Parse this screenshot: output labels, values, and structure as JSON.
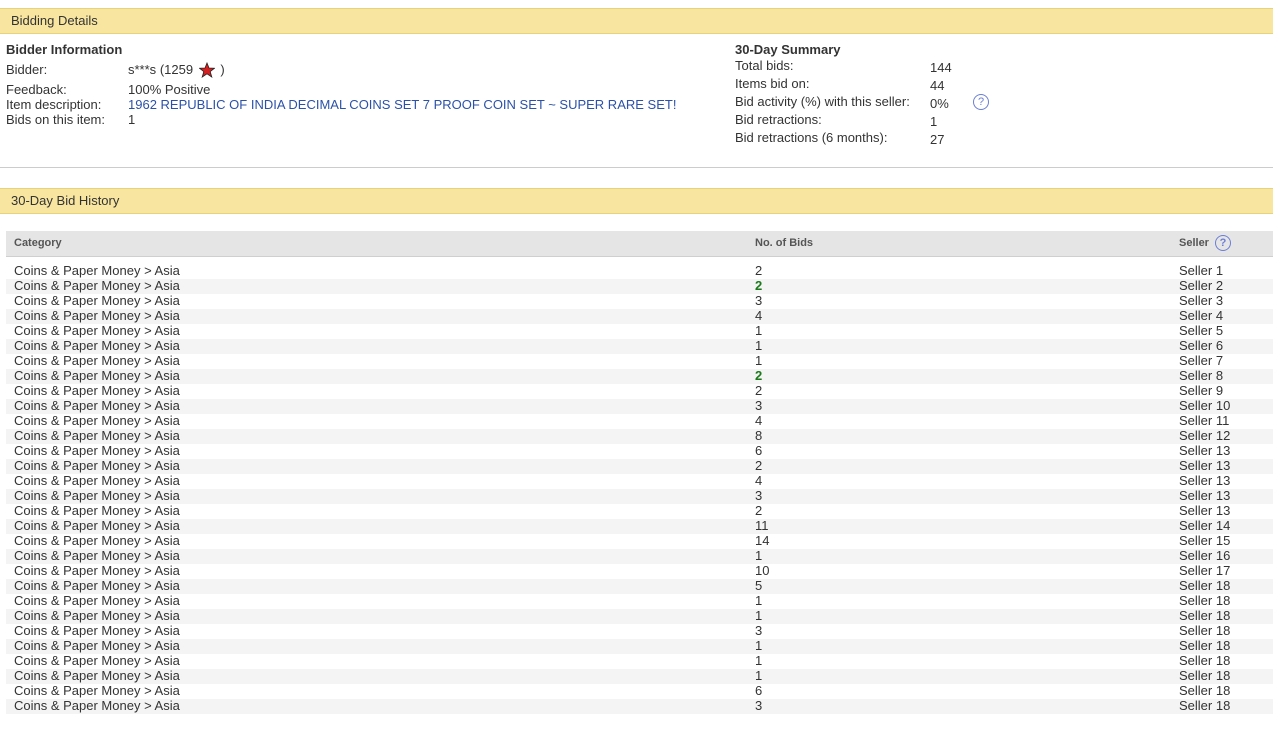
{
  "bidding_details": {
    "section_title": "Bidding Details",
    "bidder_info": {
      "title": "Bidder Information",
      "bidder_label": "Bidder:",
      "bidder_name": "s***s",
      "feedback_open": "(",
      "feedback_score": "1259",
      "feedback_close": ")",
      "star_color": "#d42020",
      "feedback_label": "Feedback:",
      "feedback_value": "100% Positive",
      "item_desc_label": "Item description:",
      "item_desc_value": "1962 REPUBLIC OF INDIA DECIMAL COINS SET 7 PROOF COIN SET ~ SUPER RARE SET!",
      "bids_on_item_label": "Bids on this item:",
      "bids_on_item_value": "1"
    },
    "summary": {
      "title": "30-Day Summary",
      "total_bids_label": "Total bids:",
      "total_bids_value": "144",
      "items_bid_label": "Items bid on:",
      "items_bid_value": "44",
      "activity_label": "Bid activity (%) with this seller:",
      "activity_value": "0%",
      "retractions_label": "Bid retractions:",
      "retractions_value": "1",
      "retractions6_label": "Bid retractions (6 months):",
      "retractions6_value": "27",
      "help_icon": "?"
    }
  },
  "history": {
    "section_title": "30-Day Bid History",
    "columns": {
      "category": "Category",
      "bids": "No. of Bids",
      "seller": "Seller",
      "help_icon": "?"
    },
    "rows": [
      {
        "category": "Coins & Paper Money > Asia",
        "bids": "2",
        "seller": "Seller 1",
        "highlight": false
      },
      {
        "category": "Coins & Paper Money > Asia",
        "bids": "2",
        "seller": "Seller 2",
        "highlight": true
      },
      {
        "category": "Coins & Paper Money > Asia",
        "bids": "3",
        "seller": "Seller 3",
        "highlight": false
      },
      {
        "category": "Coins & Paper Money > Asia",
        "bids": "4",
        "seller": "Seller 4",
        "highlight": false
      },
      {
        "category": "Coins & Paper Money > Asia",
        "bids": "1",
        "seller": "Seller 5",
        "highlight": false
      },
      {
        "category": "Coins & Paper Money > Asia",
        "bids": "1",
        "seller": "Seller 6",
        "highlight": false
      },
      {
        "category": "Coins & Paper Money > Asia",
        "bids": "1",
        "seller": "Seller 7",
        "highlight": false
      },
      {
        "category": "Coins & Paper Money > Asia",
        "bids": "2",
        "seller": "Seller 8",
        "highlight": true
      },
      {
        "category": "Coins & Paper Money > Asia",
        "bids": "2",
        "seller": "Seller 9",
        "highlight": false
      },
      {
        "category": "Coins & Paper Money > Asia",
        "bids": "3",
        "seller": "Seller 10",
        "highlight": false
      },
      {
        "category": "Coins & Paper Money > Asia",
        "bids": "4",
        "seller": "Seller 11",
        "highlight": false
      },
      {
        "category": "Coins & Paper Money > Asia",
        "bids": "8",
        "seller": "Seller 12",
        "highlight": false
      },
      {
        "category": "Coins & Paper Money > Asia",
        "bids": "6",
        "seller": "Seller 13",
        "highlight": false
      },
      {
        "category": "Coins & Paper Money > Asia",
        "bids": "2",
        "seller": "Seller 13",
        "highlight": false
      },
      {
        "category": "Coins & Paper Money > Asia",
        "bids": "4",
        "seller": "Seller 13",
        "highlight": false
      },
      {
        "category": "Coins & Paper Money > Asia",
        "bids": "3",
        "seller": "Seller 13",
        "highlight": false
      },
      {
        "category": "Coins & Paper Money > Asia",
        "bids": "2",
        "seller": "Seller 13",
        "highlight": false
      },
      {
        "category": "Coins & Paper Money > Asia",
        "bids": "11",
        "seller": "Seller 14",
        "highlight": false
      },
      {
        "category": "Coins & Paper Money > Asia",
        "bids": "14",
        "seller": "Seller 15",
        "highlight": false
      },
      {
        "category": "Coins & Paper Money > Asia",
        "bids": "1",
        "seller": "Seller 16",
        "highlight": false
      },
      {
        "category": "Coins & Paper Money > Asia",
        "bids": "10",
        "seller": "Seller 17",
        "highlight": false
      },
      {
        "category": "Coins & Paper Money > Asia",
        "bids": "5",
        "seller": "Seller 18",
        "highlight": false
      },
      {
        "category": "Coins & Paper Money > Asia",
        "bids": "1",
        "seller": "Seller 18",
        "highlight": false
      },
      {
        "category": "Coins & Paper Money > Asia",
        "bids": "1",
        "seller": "Seller 18",
        "highlight": false
      },
      {
        "category": "Coins & Paper Money > Asia",
        "bids": "3",
        "seller": "Seller 18",
        "highlight": false
      },
      {
        "category": "Coins & Paper Money > Asia",
        "bids": "1",
        "seller": "Seller 18",
        "highlight": false
      },
      {
        "category": "Coins & Paper Money > Asia",
        "bids": "1",
        "seller": "Seller 18",
        "highlight": false
      },
      {
        "category": "Coins & Paper Money > Asia",
        "bids": "1",
        "seller": "Seller 18",
        "highlight": false
      },
      {
        "category": "Coins & Paper Money > Asia",
        "bids": "6",
        "seller": "Seller 18",
        "highlight": false
      },
      {
        "category": "Coins & Paper Money > Asia",
        "bids": "3",
        "seller": "Seller 18",
        "highlight": false
      }
    ],
    "highlight_color": "#1a7a1a"
  }
}
